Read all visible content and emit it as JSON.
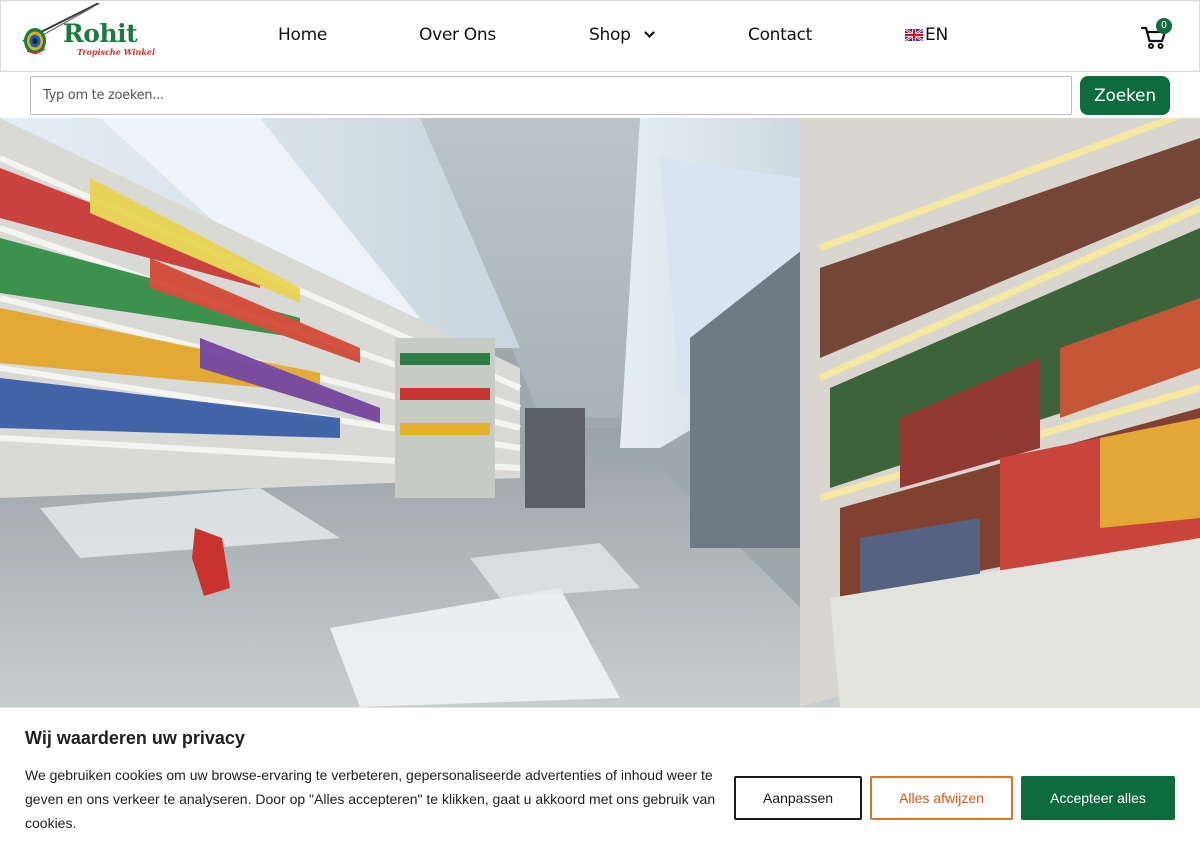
{
  "brand": {
    "name": "Rohit",
    "tagline": "Tropische Winkel",
    "colors": {
      "primary": "#0d6b3d",
      "accent": "#d0342c"
    }
  },
  "nav": {
    "home": "Home",
    "over_ons": "Over Ons",
    "shop": "Shop",
    "contact": "Contact",
    "language": "EN"
  },
  "cart": {
    "icon": "cart-icon",
    "count": "0"
  },
  "search": {
    "placeholder": "Typ om te zoeken...",
    "button": "Zoeken"
  },
  "hero": {
    "image": "supermarket-aisle-photo"
  },
  "cookie": {
    "title": "Wij waarderen uw privacy",
    "text": "We gebruiken cookies om uw browse-ervaring te verbeteren, gepersonaliseerde advertenties of inhoud weer te geven en ons verkeer te analyseren. Door op \"Alles accepteren\" te klikken, gaat u akkoord met ons gebruik van cookies.",
    "customize": "Aanpassen",
    "reject": "Alles afwijzen",
    "accept": "Accepteer alles"
  }
}
